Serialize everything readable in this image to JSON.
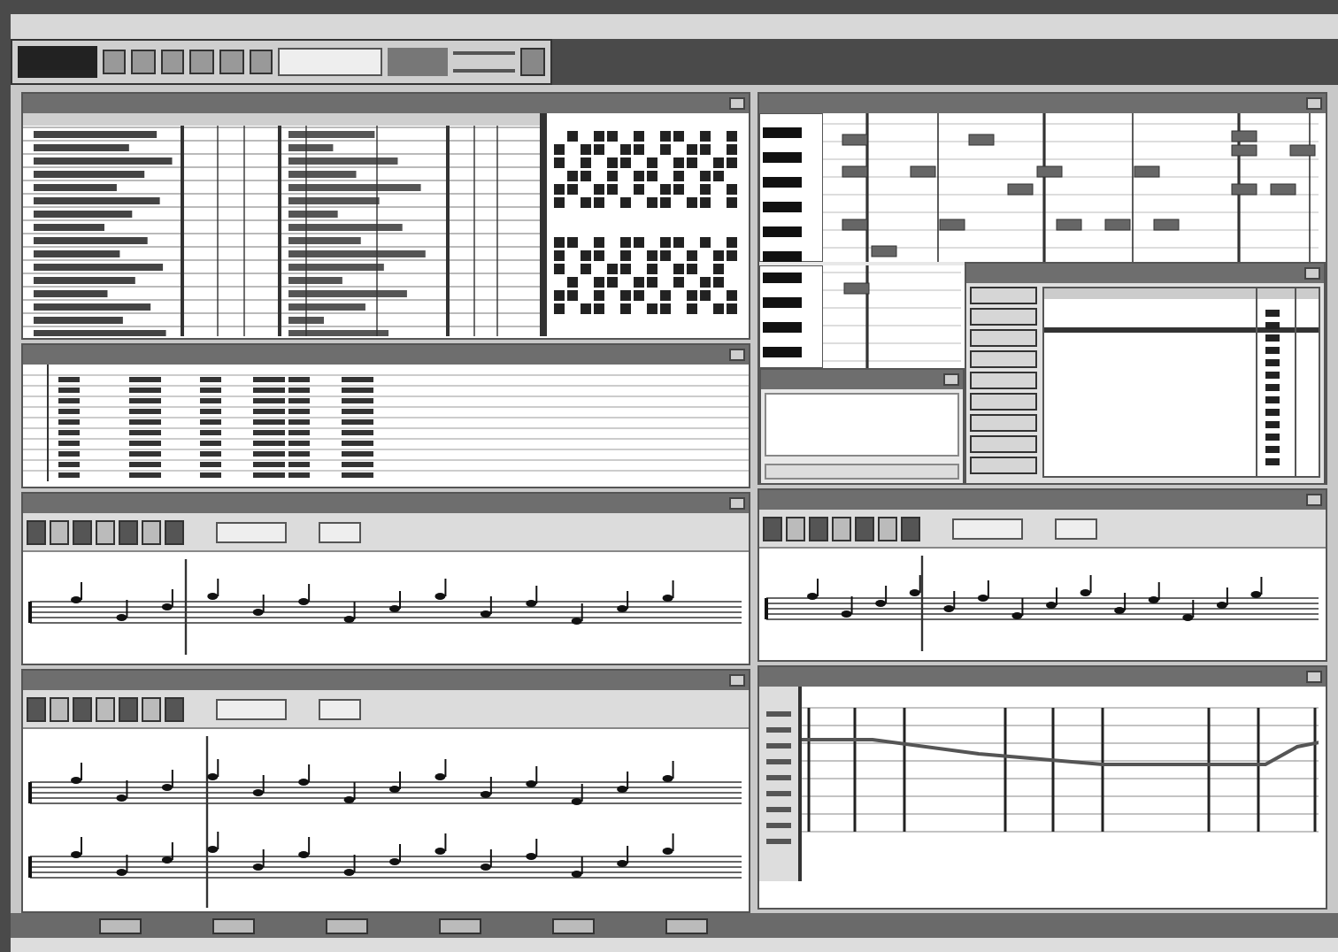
{
  "left_column": [
    {
      "kind": "arrange"
    },
    {
      "kind": "list"
    },
    {
      "kind": "score"
    },
    {
      "kind": "score_two_staves"
    }
  ],
  "right_column": [
    {
      "kind": "piano_roll",
      "overlays": [
        {
          "kind": "text_panel"
        },
        {
          "kind": "drum_list"
        }
      ]
    },
    {
      "kind": "score"
    },
    {
      "kind": "tempo"
    }
  ]
}
